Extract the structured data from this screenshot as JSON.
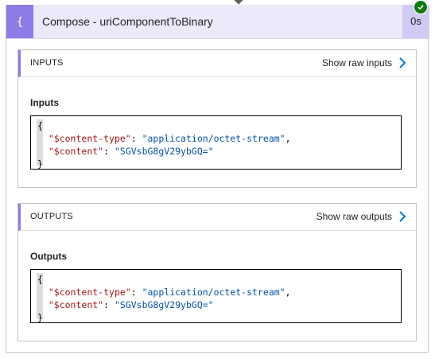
{
  "action": {
    "title": "Compose - uriComponentToBinary",
    "duration": "0s",
    "icon": "compose-braces-icon",
    "status_icon": "success-check-icon",
    "accent_color": "#8e7ce6",
    "header_bg": "#ebe9fa",
    "status_color": "#107c10"
  },
  "inputs": {
    "section_label": "INPUTS",
    "raw_link": "Show raw inputs",
    "body_label": "Inputs",
    "json": {
      "open": "{",
      "key1": "\"$content-type\"",
      "val1": "\"application/octet-stream\"",
      "key2": "\"$content\"",
      "val2": "\"SGVsbG8gV29ybGQ=\"",
      "close": "}"
    }
  },
  "outputs": {
    "section_label": "OUTPUTS",
    "raw_link": "Show raw outputs",
    "body_label": "Outputs",
    "json": {
      "open": "{",
      "key1": "\"$content-type\"",
      "val1": "\"application/octet-stream\"",
      "key2": "\"$content\"",
      "val2": "\"SGVsbG8gV29ybGQ=\"",
      "close": "}"
    }
  }
}
